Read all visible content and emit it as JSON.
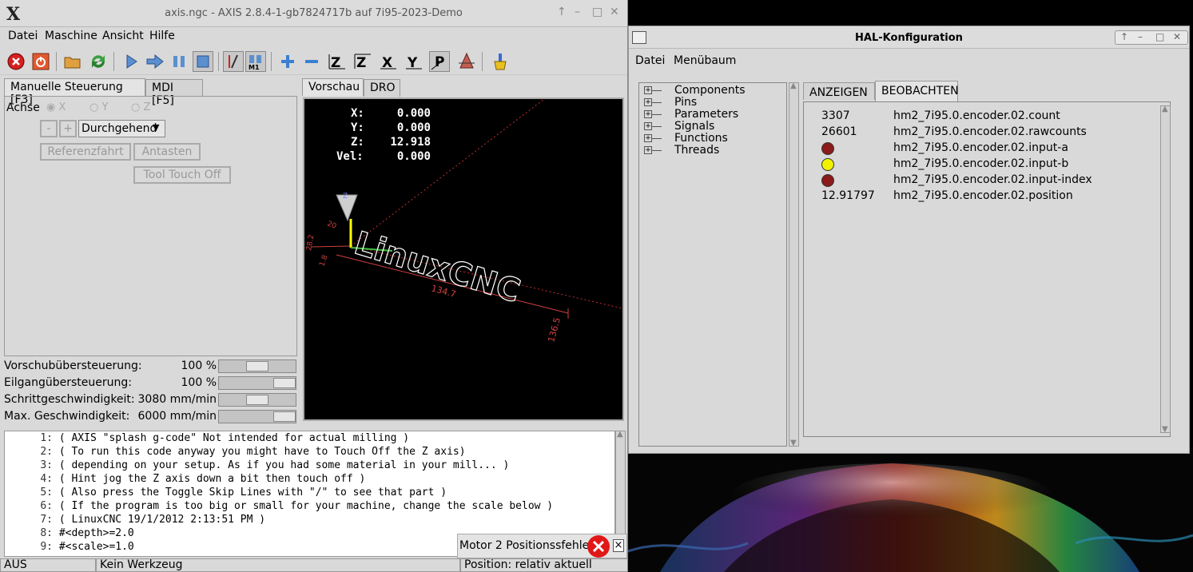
{
  "axis": {
    "title": "axis.ngc - AXIS 2.8.4-1-gb7824717b auf  7i95-2023-Demo",
    "menus": [
      "Datei",
      "Maschine",
      "Ansicht",
      "Hilfe"
    ],
    "tabs_left": {
      "manual": "Manuelle Steuerung [F3]",
      "mdi": "MDI [F5]"
    },
    "tabs_right": {
      "preview": "Vorschau",
      "dro": "DRO"
    },
    "axis_label": "Achse",
    "axes": [
      "X",
      "Y",
      "Z"
    ],
    "jog_minus": "-",
    "jog_plus": "+",
    "jog_mode": "Durchgehend",
    "home_button": "Referenzfahrt",
    "probe_button": "Antasten",
    "touchoff_button": "Tool Touch Off",
    "sliders": [
      {
        "label": "Vorschubübersteuerung:",
        "value": "100 %",
        "level": 0.5
      },
      {
        "label": "Eilgangübersteuerung:",
        "value": "100 %",
        "level": 1.0
      },
      {
        "label": "Schrittgeschwindigkeit:",
        "value": "3080 mm/min",
        "level": 0.5
      },
      {
        "label": "Max. Geschwindigkeit:",
        "value": "6000 mm/min",
        "level": 1.0
      }
    ],
    "dro": {
      "x_label": "X:",
      "x": "0.000",
      "y_label": "Y:",
      "y": "0.000",
      "z_label": "Z:",
      "z": "12.918",
      "vel_label": "Vel:",
      "vel": "0.000"
    },
    "preview_text": {
      "logo": "LinuxCNC",
      "dim1": "134.7",
      "dim2": "136.5",
      "dim3": "20",
      "dim4": "28.2",
      "dim5": "1.8"
    },
    "code_lines": [
      {
        "n": "1:",
        "t": "( AXIS \"splash g-code\" Not intended for actual milling )"
      },
      {
        "n": "2:",
        "t": "( To run this code anyway you might have to Touch Off the Z axis)"
      },
      {
        "n": "3:",
        "t": "( depending on your setup. As if you had some material in your mill... )"
      },
      {
        "n": "4:",
        "t": "( Hint jog the Z axis down a bit then touch off )"
      },
      {
        "n": "5:",
        "t": "( Also press the Toggle Skip Lines with \"/\" to see that part )"
      },
      {
        "n": "6:",
        "t": "( If the program is too big or small for your machine, change the scale below )"
      },
      {
        "n": "7:",
        "t": "( LinuxCNC 19/1/2012 2:13:51 PM )"
      },
      {
        "n": "8:",
        "t": "#<depth>=2.0"
      },
      {
        "n": "9:",
        "t": "#<scale>=1.0"
      }
    ],
    "status_state": "AUS",
    "status_tool": "Kein Werkzeug",
    "status_position": "Position: relativ aktuell",
    "error_message": "Motor 2 Positionssfehler",
    "error_close": "×"
  },
  "hal": {
    "title": "HAL-Konfiguration",
    "menus": [
      "Datei",
      "Menübaum"
    ],
    "tree": [
      "Components",
      "Pins",
      "Parameters",
      "Signals",
      "Functions",
      "Threads"
    ],
    "tabs": {
      "show": "ANZEIGEN",
      "watch": "BEOBACHTEN"
    },
    "watch": [
      {
        "kind": "value",
        "value": "3307",
        "name": "hm2_7i95.0.encoder.02.count"
      },
      {
        "kind": "value",
        "value": "26601",
        "name": "hm2_7i95.0.encoder.02.rawcounts"
      },
      {
        "kind": "led",
        "color": "#8b1a1a",
        "name": "hm2_7i95.0.encoder.02.input-a"
      },
      {
        "kind": "led",
        "color": "#f2f200",
        "name": "hm2_7i95.0.encoder.02.input-b"
      },
      {
        "kind": "led",
        "color": "#8b1a1a",
        "name": "hm2_7i95.0.encoder.02.input-index"
      },
      {
        "kind": "value",
        "value": "12.91797",
        "name": "hm2_7i95.0.encoder.02.position"
      }
    ]
  }
}
